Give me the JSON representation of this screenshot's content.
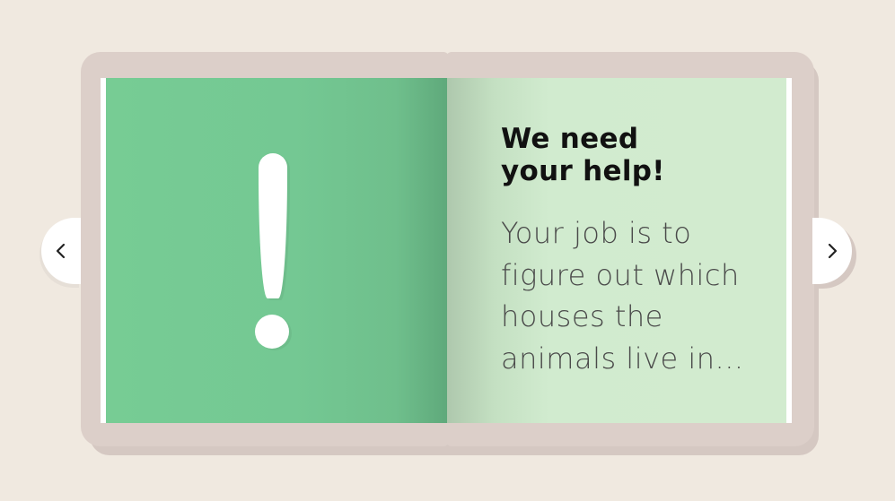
{
  "navigation": {
    "prev_icon": "chevron-left-icon",
    "next_icon": "chevron-right-icon"
  },
  "left_page": {
    "illustration": "exclamation-mark-icon",
    "background_color": "#77cc94"
  },
  "right_page": {
    "heading_line1": "We need",
    "heading_line2": "your help!",
    "body_lines": [
      "Your job is to",
      "figure out which",
      "houses the",
      "animals live in..."
    ],
    "background_color": "#d2ebcf"
  }
}
